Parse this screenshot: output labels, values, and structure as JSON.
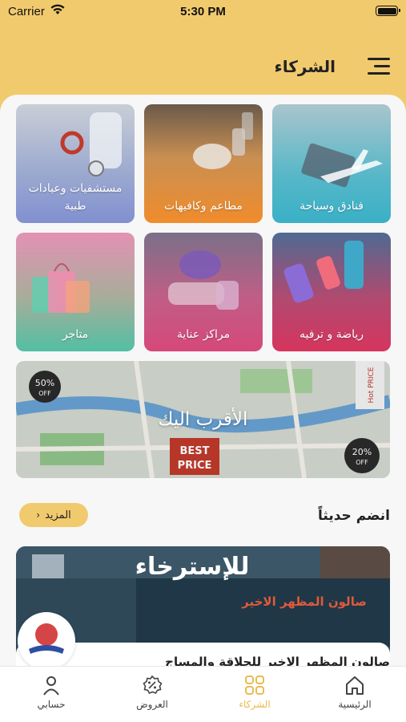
{
  "status_bar": {
    "carrier": "Carrier",
    "time": "5:30 PM"
  },
  "header": {
    "title": "الشركاء",
    "menu_icon": "hamburger-menu-icon"
  },
  "categories": [
    {
      "label": "فنادق وسياحة"
    },
    {
      "label": "مطاعم وكافيهات"
    },
    {
      "label": "مستشفيات وعيادات طبية"
    },
    {
      "label": "رياضة و ترفيه"
    },
    {
      "label": "مراكز عناية"
    },
    {
      "label": "متاجر"
    }
  ],
  "nearby_banner": {
    "label": "الأقرب اليك",
    "badges": {
      "discount_left": "50%",
      "discount_left_sub": "OFF",
      "discount_right": "20%",
      "discount_right_sub": "OFF",
      "best_price_line1": "BEST",
      "best_price_line2": "PRICE",
      "hot_price": "Hot PRICE"
    }
  },
  "recent_section": {
    "title": "انضم حديثاً",
    "more_label": "المزيد"
  },
  "featured_partner": {
    "name": "صالون المظهر الاخير للحلاقة والمساج",
    "sign_text_1": "للإسترخاء",
    "sign_text_2": "صالون المظهر الاخير"
  },
  "tab_bar": [
    {
      "label": "حسابي",
      "icon": "user-icon"
    },
    {
      "label": "العروض",
      "icon": "discount-badge-icon"
    },
    {
      "label": "الشركاء",
      "icon": "grid-icon",
      "active": true
    },
    {
      "label": "الرئيسية",
      "icon": "home-icon"
    }
  ],
  "colors": {
    "brand": "#f2ca6e",
    "active_tab": "#e9bb50",
    "background": "#f7f7f7"
  }
}
